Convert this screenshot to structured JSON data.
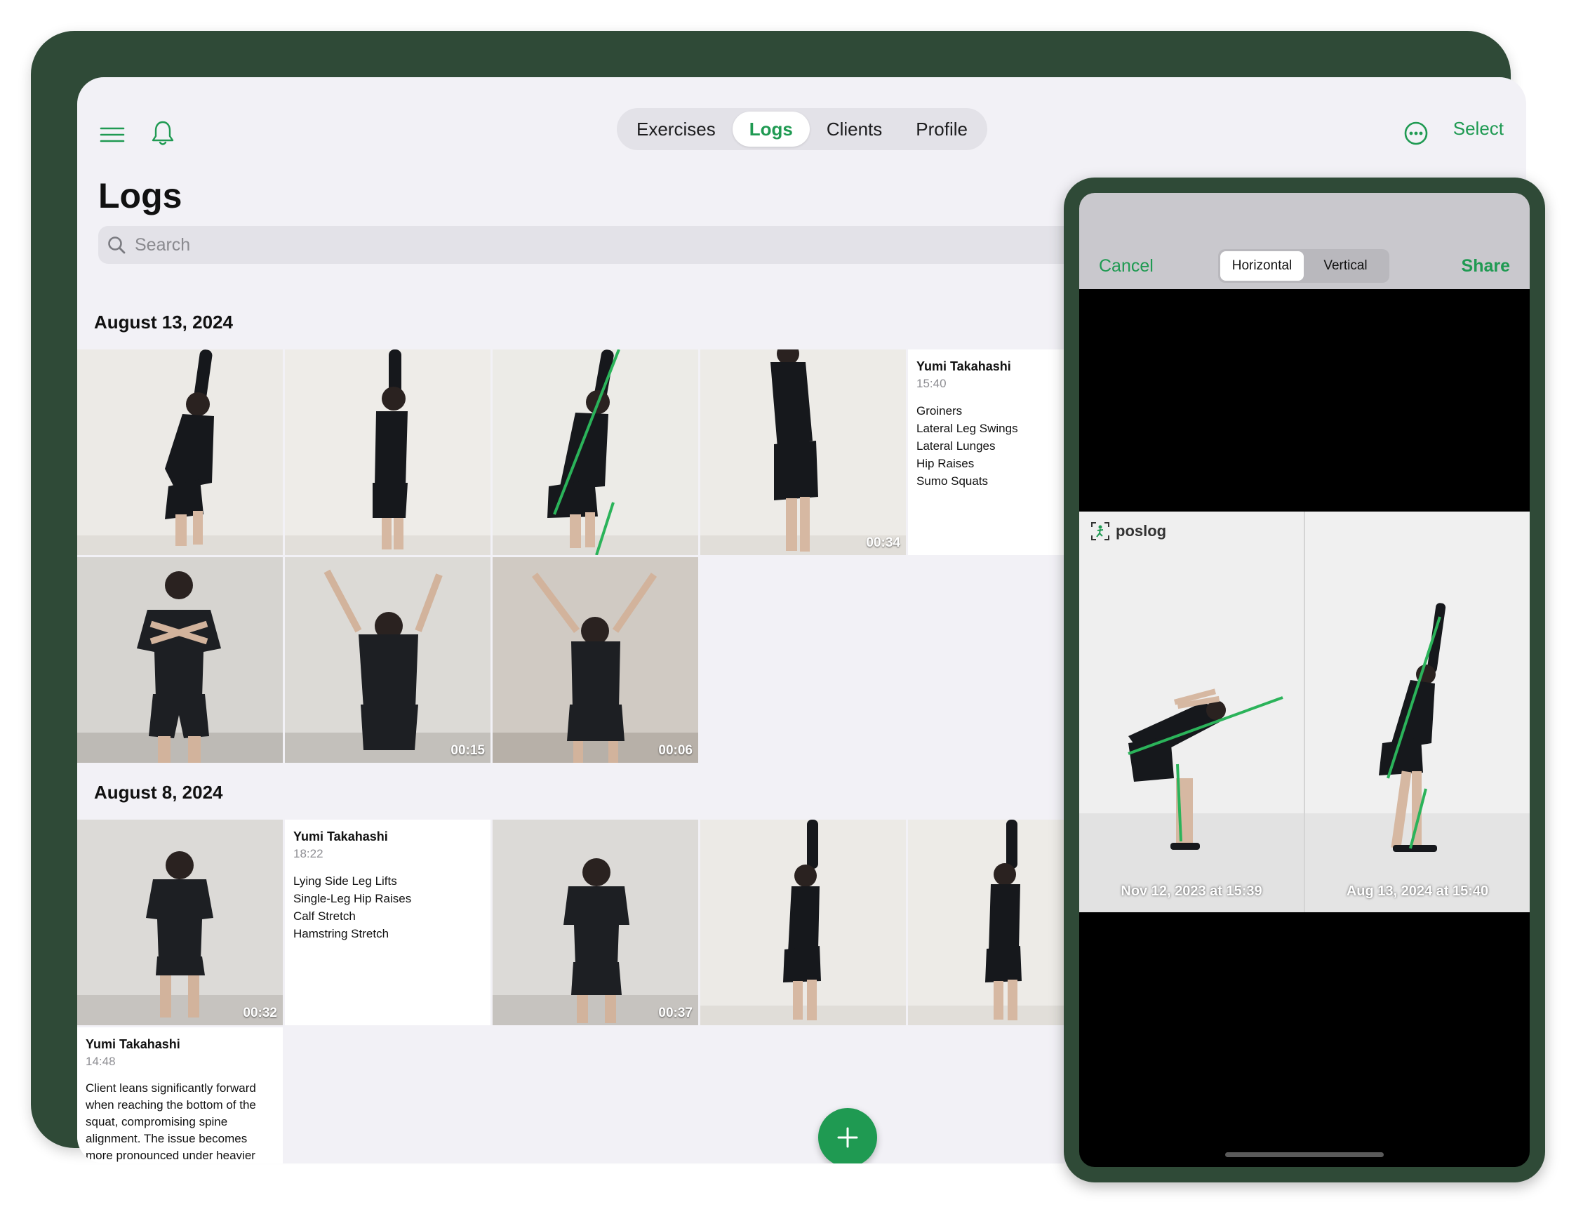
{
  "nav": {
    "tabs": [
      {
        "label": "Exercises",
        "active": false
      },
      {
        "label": "Logs",
        "active": true
      },
      {
        "label": "Clients",
        "active": false
      },
      {
        "label": "Profile",
        "active": false
      }
    ],
    "select_label": "Select",
    "menu_icon": "hamburger-menu-icon",
    "bell_icon": "bell-icon",
    "more_icon": "ellipsis-circle-icon"
  },
  "page": {
    "title": "Logs",
    "search_placeholder": "Search"
  },
  "sections": [
    {
      "date": "August 13, 2024",
      "durations": [
        "00:34",
        "00:15",
        "00:06"
      ],
      "note": {
        "name": "Yumi Takahashi",
        "time": "15:40",
        "exercises": [
          "Groiners",
          "Lateral Leg Swings",
          "Lateral Lunges",
          "Hip Raises",
          "Sumo Squats"
        ]
      }
    },
    {
      "date": "August 8, 2024",
      "durations": [
        "00:32",
        "00:37"
      ],
      "note": {
        "name": "Yumi Takahashi",
        "time": "18:22",
        "exercises": [
          "Lying Side Leg Lifts",
          "Single-Leg Hip Raises",
          "Calf Stretch",
          "Hamstring Stretch"
        ]
      },
      "note2": {
        "name": "Yumi Takahashi",
        "time": "14:48",
        "text": "Client leans significantly forward when reaching the bottom of the squat, compromising spine alignment. The issue becomes more pronounced under heavier"
      }
    }
  ],
  "phone": {
    "cancel_label": "Cancel",
    "share_label": "Share",
    "segments": [
      {
        "label": "Horizontal",
        "active": true
      },
      {
        "label": "Vertical",
        "active": false
      }
    ],
    "brand": "poslog",
    "compare": [
      {
        "date": "Nov 12, 2023 at 15:39"
      },
      {
        "date": "Aug 13, 2024 at 15:40"
      }
    ]
  },
  "colors": {
    "accent": "#1f9a52",
    "device_frame": "#2f4a37",
    "overlay_line": "#2bb35a"
  }
}
